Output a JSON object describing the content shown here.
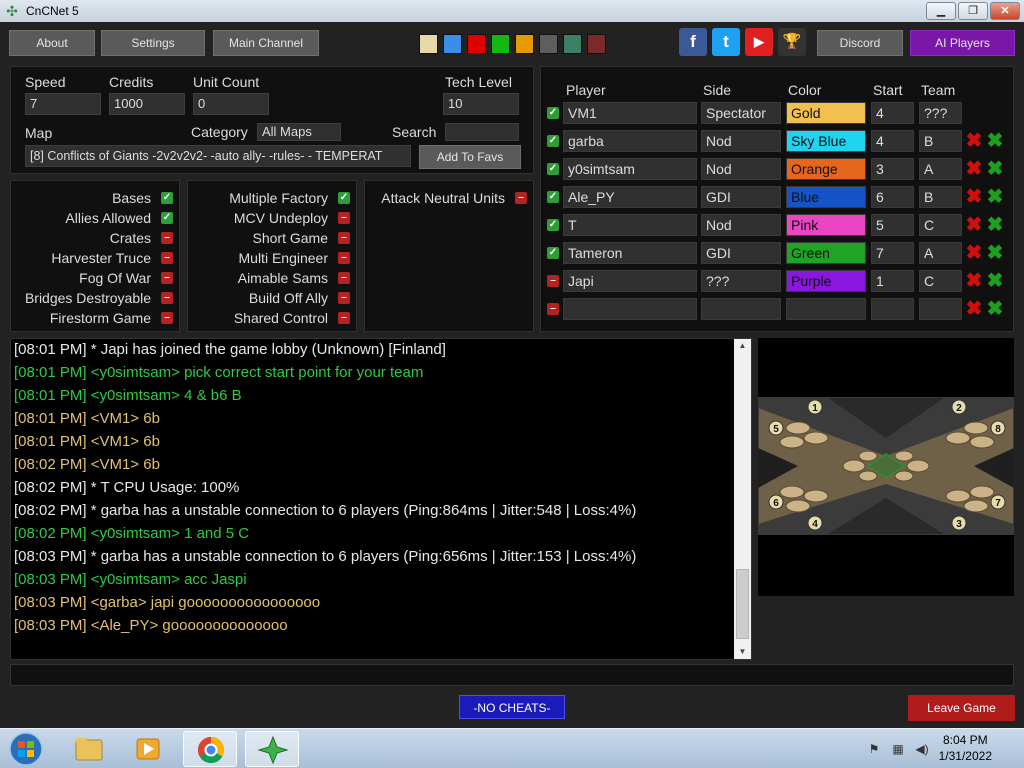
{
  "window": {
    "title": "CnCNet 5",
    "min": "▁",
    "max": "❐",
    "close": "✕"
  },
  "toolbar": {
    "about": "About",
    "settings": "Settings",
    "main_channel": "Main Channel",
    "discord": "Discord",
    "ai_players": "AI Players",
    "swatch_colors": [
      "#e6d8a8",
      "#3b8ee8",
      "#e00000",
      "#14b814",
      "#e49a00",
      "#5e5e5e",
      "#3f7f64",
      "#7a2a2a"
    ],
    "facebook": "f",
    "twitter": "t",
    "youtube": "▶",
    "trophy": "🏆"
  },
  "settings": {
    "speed_label": "Speed",
    "speed": "7",
    "credits_label": "Credits",
    "credits": "1000",
    "unit_count_label": "Unit Count",
    "unit_count": "0",
    "tech_level_label": "Tech Level",
    "tech_level": "10",
    "map_label": "Map",
    "map": "[8] Conflicts of Giants -2v2v2v2- -auto ally- -rules- - TEMPERAT",
    "category_label": "Category",
    "category": "All Maps",
    "search_label": "Search",
    "search": "",
    "add_to_favs": "Add To Favs"
  },
  "options": {
    "col1": [
      {
        "label": "Bases",
        "on": true
      },
      {
        "label": "Allies Allowed",
        "on": true
      },
      {
        "label": "Crates",
        "on": false
      },
      {
        "label": "Harvester Truce",
        "on": false
      },
      {
        "label": "Fog Of War",
        "on": false
      },
      {
        "label": "Bridges Destroyable",
        "on": false
      },
      {
        "label": "Firestorm Game",
        "on": false
      }
    ],
    "col2": [
      {
        "label": "Multiple Factory",
        "on": true
      },
      {
        "label": "MCV Undeploy",
        "on": false
      },
      {
        "label": "Short Game",
        "on": false
      },
      {
        "label": "Multi Engineer",
        "on": false
      },
      {
        "label": "Aimable Sams",
        "on": false
      },
      {
        "label": "Build Off Ally",
        "on": false
      },
      {
        "label": "Shared Control",
        "on": false
      }
    ],
    "col3": [
      {
        "label": "Attack Neutral Units",
        "on": false
      }
    ]
  },
  "players": {
    "headers": {
      "player": "Player",
      "side": "Side",
      "color": "Color",
      "start": "Start",
      "team": "Team"
    },
    "rows": [
      {
        "ready": true,
        "name": "VM1",
        "side": "Spectator",
        "color": "Gold",
        "color_hex": "#f2c04e",
        "start": "4",
        "team": "???",
        "kick": false
      },
      {
        "ready": true,
        "name": "garba",
        "side": "Nod",
        "color": "Sky Blue",
        "color_hex": "#1fd4f0",
        "start": "4",
        "team": "B",
        "kick": true
      },
      {
        "ready": true,
        "name": "y0simtsam",
        "side": "Nod",
        "color": "Orange",
        "color_hex": "#e5661c",
        "start": "3",
        "team": "A",
        "kick": true
      },
      {
        "ready": true,
        "name": "Ale_PY",
        "side": "GDI",
        "color": "Blue",
        "color_hex": "#1454c8",
        "start": "6",
        "team": "B",
        "kick": true
      },
      {
        "ready": true,
        "name": "T",
        "side": "Nod",
        "color": "Pink",
        "color_hex": "#ea46c4",
        "start": "5",
        "team": "C",
        "kick": true
      },
      {
        "ready": true,
        "name": "Tameron",
        "side": "GDI",
        "color": "Green",
        "color_hex": "#1fa425",
        "start": "7",
        "team": "A",
        "kick": true
      },
      {
        "ready": false,
        "name": "Japi",
        "side": "???",
        "color": "Purple",
        "color_hex": "#8a17e0",
        "start": "1",
        "team": "C",
        "kick": true
      },
      {
        "ready": false,
        "name": "",
        "side": "",
        "color": "",
        "color_hex": "#303030",
        "start": "",
        "team": "",
        "kick": true
      }
    ]
  },
  "chat": [
    {
      "text": "[08:01 PM] * Japi has joined the game lobby (Unknown) [Finland]",
      "color": "#e8e8e8"
    },
    {
      "text": "[08:01 PM] <y0simtsam> pick correct start point for your team",
      "color": "#2ecc40"
    },
    {
      "text": "[08:01 PM] <y0simtsam> 4 & b6 B",
      "color": "#2ecc40"
    },
    {
      "text": "[08:01 PM] <VM1> 6b",
      "color": "#e3c170"
    },
    {
      "text": "[08:01 PM] <VM1> 6b",
      "color": "#e3c170"
    },
    {
      "text": "[08:02 PM] <VM1> 6b",
      "color": "#e3c170"
    },
    {
      "text": "[08:02 PM] * T CPU Usage: 100%",
      "color": "#e8e8e8"
    },
    {
      "text": "[08:02 PM] * garba has a unstable connection to 6 players (Ping:864ms | Jitter:548 | Loss:4%)",
      "color": "#e8e8e8"
    },
    {
      "text": "[08:02 PM] <y0simtsam> 1 and 5 C",
      "color": "#2ecc40"
    },
    {
      "text": "[08:03 PM] * garba has a unstable connection to 6 players (Ping:656ms | Jitter:153 | Loss:4%)",
      "color": "#e8e8e8"
    },
    {
      "text": "[08:03 PM] <y0simtsam> acc Jaspi",
      "color": "#2ecc40"
    },
    {
      "text": "[08:03 PM] <garba> japi goooooooooooooooo",
      "color": "#e3c170"
    },
    {
      "text": "[08:03 PM] <Ale_PY> goooooooooooooo",
      "color": "#e3c170"
    }
  ],
  "map_preview": {
    "start_labels": [
      "1",
      "2",
      "3",
      "4",
      "5",
      "6",
      "7",
      "8"
    ]
  },
  "bottom": {
    "no_cheats": "-NO CHEATS-",
    "leave_game": "Leave Game"
  },
  "taskbar": {
    "time": "8:04 PM",
    "date": "1/31/2022"
  }
}
